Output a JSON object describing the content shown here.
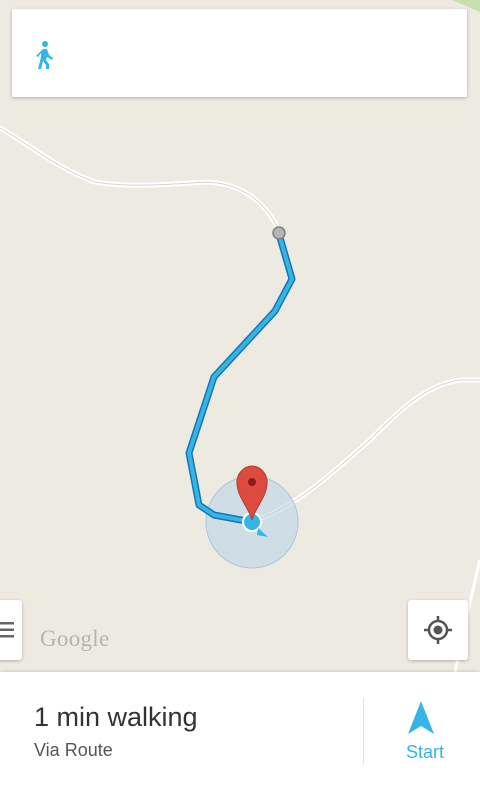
{
  "directions_card": {
    "mode_icon": "walking-person-icon"
  },
  "map": {
    "logo_text": "Google",
    "menu_icon": "menu-icon",
    "locate_icon": "my-location-icon",
    "destination_icon": "map-pin-icon",
    "accent_color": "#33b5e5",
    "pin_color": "#dd4b3e"
  },
  "route_summary": {
    "duration": "1 min walking",
    "via": "Via Route",
    "start_label": "Start",
    "start_icon": "navigation-arrow-icon"
  }
}
